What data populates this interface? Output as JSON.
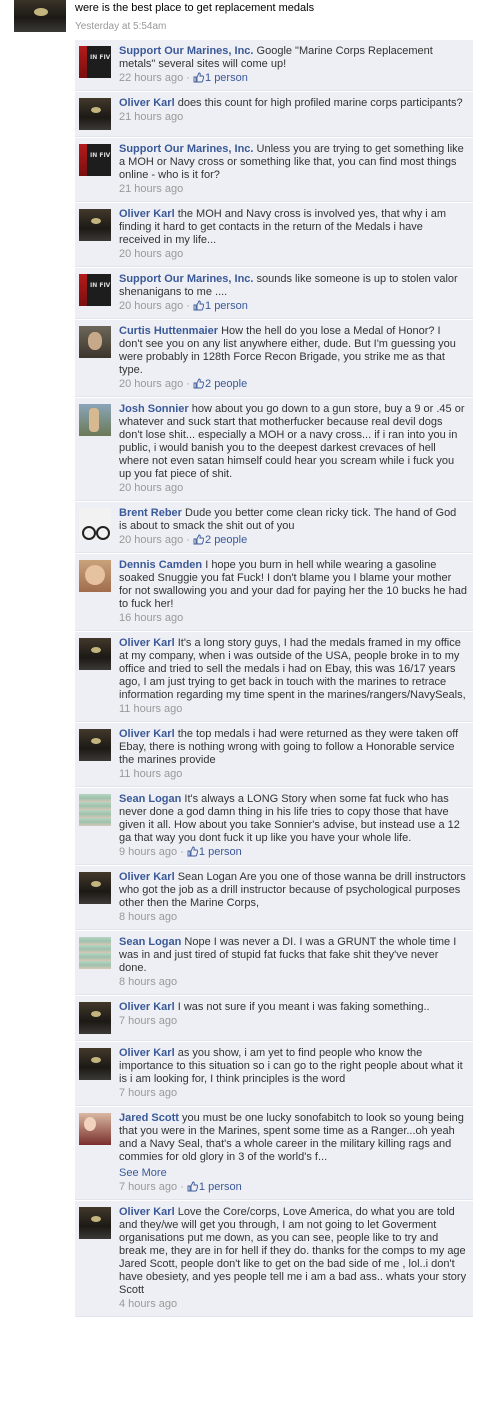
{
  "post": {
    "text": "were is the best place to get replacement medals",
    "time": "Yesterday at 5:54am"
  },
  "som_avatar_text": "IN FIV",
  "comments": [
    {
      "author": "Support Our Marines, Inc.",
      "avatar": "som",
      "text": "Google \"Marine Corps Replacement metals\" several sites will come up!",
      "time": "22 hours ago",
      "likes": "1 person"
    },
    {
      "author": "Oliver Karl",
      "avatar": "oliver",
      "text": "does this count for high profiled marine corps participants?",
      "time": "21 hours ago",
      "likes": ""
    },
    {
      "author": "Support Our Marines, Inc.",
      "avatar": "som",
      "text": "Unless you are trying to get something like a MOH or Navy cross or something like that, you can find most things online - who is it for?",
      "time": "21 hours ago",
      "likes": ""
    },
    {
      "author": "Oliver Karl",
      "avatar": "oliver",
      "text": "the MOH and Navy cross is involved yes, that why i am finding it hard to get contacts in the return of the Medals i have received in my life...",
      "time": "20 hours ago",
      "likes": ""
    },
    {
      "author": "Support Our Marines, Inc.",
      "avatar": "som",
      "text": "sounds like someone is up to stolen valor shenanigans to me ....",
      "time": "20 hours ago",
      "likes": "1 person"
    },
    {
      "author": "Curtis Huttenmaier",
      "avatar": "curtis",
      "text": "How the hell do you lose a Medal of Honor? I don't see you on any list anywhere either, dude. But I'm guessing you were probably in 128th Force Recon Brigade, you strike me as that type.",
      "time": "20 hours ago",
      "likes": "2 people"
    },
    {
      "author": "Josh Sonnier",
      "avatar": "josh",
      "text": "how about you go down to a gun store, buy a 9 or .45 or whatever and suck start that motherfucker because real devil dogs don't lose shit... especially a MOH or a navy cross... if i ran into you in public, i would banish you to the deepest darkest crevaces of hell where not even satan himself could hear you scream while i fuck you up you fat piece of shit.",
      "time": "20 hours ago",
      "likes": ""
    },
    {
      "author": "Brent Reber",
      "avatar": "brent",
      "text": "Dude you better come clean ricky tick. The hand of God is about to smack the shit out of you",
      "time": "20 hours ago",
      "likes": "2 people"
    },
    {
      "author": "Dennis Camden",
      "avatar": "dennis",
      "text": "I hope you burn in hell while wearing a gasoline soaked Snuggie you fat Fuck! I don't blame you I blame your mother for not swallowing you and your dad for paying her the 10 bucks he had to fuck her!",
      "time": "16 hours ago",
      "likes": ""
    },
    {
      "author": "Oliver Karl",
      "avatar": "oliver",
      "text": "It's a long story guys, I had the medals framed in my office at my company, when i was outside of the USA, people broke in to my office and tried to sell the medals i had on Ebay, this was 16/17 years ago, I am just trying to get back in touch with the marines to retrace information regarding my time spent in the marines/rangers/NavySeals,",
      "time": "11 hours ago",
      "likes": ""
    },
    {
      "author": "Oliver Karl",
      "avatar": "oliver",
      "text": "the top medals i had were returned as they were taken off Ebay, there is nothing wrong with going to follow a Honorable service the marines provide",
      "time": "11 hours ago",
      "likes": ""
    },
    {
      "author": "Sean Logan",
      "avatar": "sean",
      "text": "It's always a LONG Story when some fat fuck who has never done a god damn thing in his life tries to copy those that have given it all. How about you take Sonnier's advise, but instead use a 12 ga that way you dont fuck it up like you have your whole life.",
      "time": "9 hours ago",
      "likes": "1 person"
    },
    {
      "author": "Oliver Karl",
      "avatar": "oliver",
      "text": "Sean Logan Are you one of those wanna be drill instructors who got the job as a drill instructor because of psychological purposes other then the Marine Corps,",
      "time": "8 hours ago",
      "likes": ""
    },
    {
      "author": "Sean Logan",
      "avatar": "sean",
      "text": "Nope I was never a DI. I was a GRUNT the whole time I was in and just tired of stupid fat fucks that fake shit they've never done.",
      "time": "8 hours ago",
      "likes": ""
    },
    {
      "author": "Oliver Karl",
      "avatar": "oliver",
      "text": "I was not sure if you meant i was faking something..",
      "time": "7 hours ago",
      "likes": ""
    },
    {
      "author": "Oliver Karl",
      "avatar": "oliver",
      "text": "as you show, i am yet to find people who know the importance to this situation so i can go to the right people about what it is i am looking for, I think principles is the word",
      "time": "7 hours ago",
      "likes": ""
    },
    {
      "author": "Jared Scott",
      "avatar": "jared",
      "text": "you must be one lucky sonofabitch to look so young being that you were in the Marines, spent some time as a Ranger...oh yeah and a Navy Seal, that's a whole career in the military killing rags and commies for old glory in 3 of the world's f...",
      "see_more": "See More",
      "time": "7 hours ago",
      "likes": "1 person"
    },
    {
      "author": "Oliver Karl",
      "avatar": "oliver",
      "text": "Love the Core/corps, Love America, do what you are told and they/we will get you through, I am not going to let Goverment organisations put me down, as you can see, people like to try and break me, they are in for hell if they do. thanks for the comps to my age Jared Scott, people don't like to get on the bad side of me , lol..i don't have obesiety, and yes people tell me i am a bad ass.. whats your story Scott",
      "time": "4 hours ago",
      "likes": ""
    }
  ]
}
